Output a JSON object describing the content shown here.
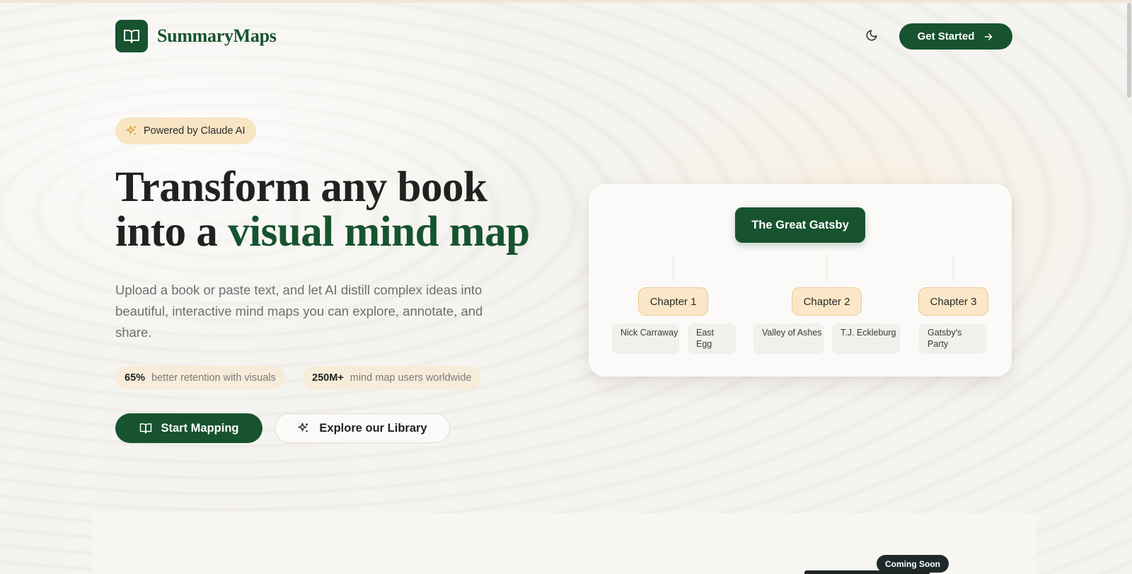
{
  "header": {
    "brand": "SummaryMaps",
    "cta_label": "Get Started",
    "icons": {
      "logo": "open-book-icon",
      "theme": "moon-icon",
      "cta": "arrow-right-icon"
    }
  },
  "hero": {
    "badge": "Powered by Claude AI",
    "headline_line1": "Transform any book",
    "headline_line2_prefix": "into a ",
    "headline_line2_accent": "visual mind map",
    "description": "Upload a book or paste text, and let AI distill complex ideas into beautiful, interactive mind maps you can explore, annotate, and share.",
    "stats": [
      {
        "value": "65%",
        "label": "better retention with visuals"
      },
      {
        "value": "250M+",
        "label": "mind map users worldwide"
      }
    ],
    "primary_button": "Start Mapping",
    "secondary_button": "Explore our Library"
  },
  "mind_map": {
    "root": "The Great Gatsby",
    "chapters": [
      {
        "label": "Chapter 1",
        "children": [
          {
            "label": "Nick Carraway"
          },
          {
            "label": "East Egg"
          }
        ]
      },
      {
        "label": "Chapter 2",
        "children": [
          {
            "label": "Valley of Ashes"
          },
          {
            "label": "T.J. Eckleburg"
          }
        ]
      },
      {
        "label": "Chapter 3",
        "children": [
          {
            "label": "Gatsby's Party"
          }
        ]
      }
    ]
  },
  "lower_section": {
    "badge": "Coming Soon"
  },
  "colors": {
    "brand_green": "#17532f",
    "chapter_fill": "#fbe7c7",
    "badge_fill": "#f8e5c4",
    "background": "#f6f4f0"
  }
}
